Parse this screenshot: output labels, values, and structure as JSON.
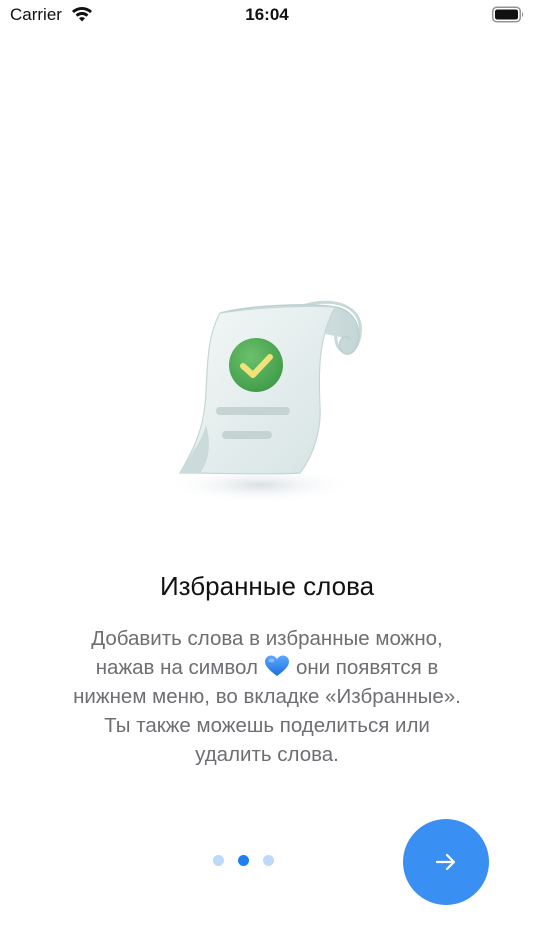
{
  "status_bar": {
    "carrier": "Carrier",
    "time": "16:04"
  },
  "onboarding": {
    "title": "Избранные слова",
    "description_line1": "Добавить слова в избранные можно,",
    "description_line2_before": "нажав на символ",
    "description_line2_after": "они появятся в",
    "description_line3": "нижнем меню, во вкладке «Избранные».",
    "description_line4": "Ты также можешь поделиться или",
    "description_line5": "удалить слова.",
    "heart_icon": "blue-heart-icon"
  },
  "pagination": {
    "total": 3,
    "active_index": 1
  },
  "colors": {
    "accent": "#3a8ff2",
    "dot_active": "#1f7ff0",
    "dot_inactive": "#bcd9fa",
    "description_text": "#6e6e73"
  },
  "icons": {
    "next": "arrow-right-icon",
    "illustration": "receipt-check-icon"
  }
}
